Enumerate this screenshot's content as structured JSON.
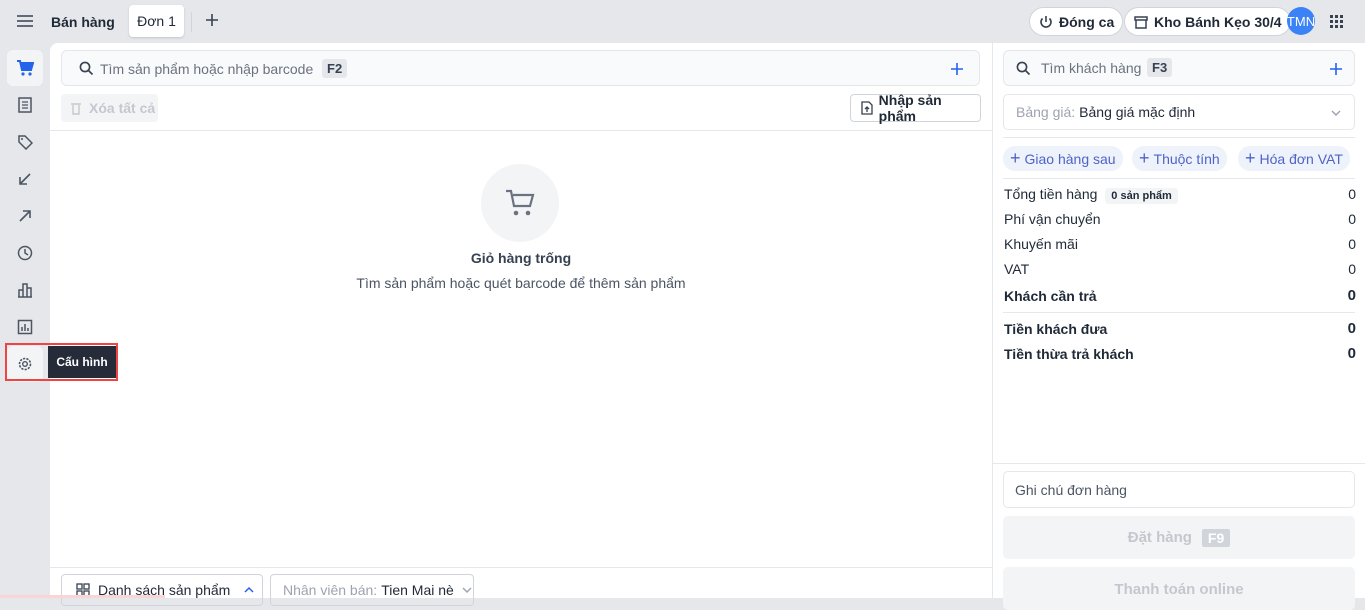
{
  "header": {
    "title": "Bán hàng",
    "tabs": [
      {
        "label": "Đơn 1"
      }
    ],
    "close_shift": "Đóng ca",
    "store": "Kho Bánh Kẹo 30/4",
    "avatar": "TMN"
  },
  "sidebar": {
    "tooltip": "Cấu hình",
    "items": [
      "cart-icon",
      "list-icon",
      "tag-icon",
      "arrow-down-left-icon",
      "arrow-up-right-icon",
      "clock-icon",
      "bar-chart-icon",
      "report-icon",
      "gear-icon"
    ]
  },
  "main": {
    "search_placeholder": "Tìm sản phẩm hoặc nhập barcode",
    "search_key": "F2",
    "clear_all": "Xóa tất cả",
    "import": "Nhập sản phẩm",
    "empty_title": "Giỏ hàng trống",
    "empty_desc": "Tìm sản phẩm hoặc quét barcode để thêm sản phẩm",
    "product_list": "Danh sách sản phẩm",
    "seller_label": "Nhân viên bán:",
    "seller_value": "Tien Mai nè"
  },
  "right": {
    "customer_placeholder": "Tìm khách hàng",
    "customer_key": "F3",
    "pricelist_label": "Bảng giá:",
    "pricelist_value": "Bảng giá mặc định",
    "chips": [
      "Giao hàng sau",
      "Thuộc tính",
      "Hóa đơn VAT"
    ],
    "summary": [
      {
        "label": "Tổng tiền hàng",
        "badge": "0 sản phẩm",
        "value": "0"
      },
      {
        "label": "Phí vận chuyển",
        "value": "0"
      },
      {
        "label": "Khuyến mãi",
        "value": "0"
      },
      {
        "label": "VAT",
        "value": "0"
      },
      {
        "label": "Khách cần trả",
        "value": "0"
      },
      {
        "label": "Tiền khách đưa",
        "value": "0"
      },
      {
        "label": "Tiền thừa trả khách",
        "value": "0"
      }
    ],
    "note_placeholder": "Ghi chú đơn hàng",
    "order": "Đặt hàng",
    "order_key": "F9",
    "pay_online": "Thanh toán online"
  },
  "colors": {
    "accent": "#2563eb",
    "highlight": "#ef4444"
  }
}
